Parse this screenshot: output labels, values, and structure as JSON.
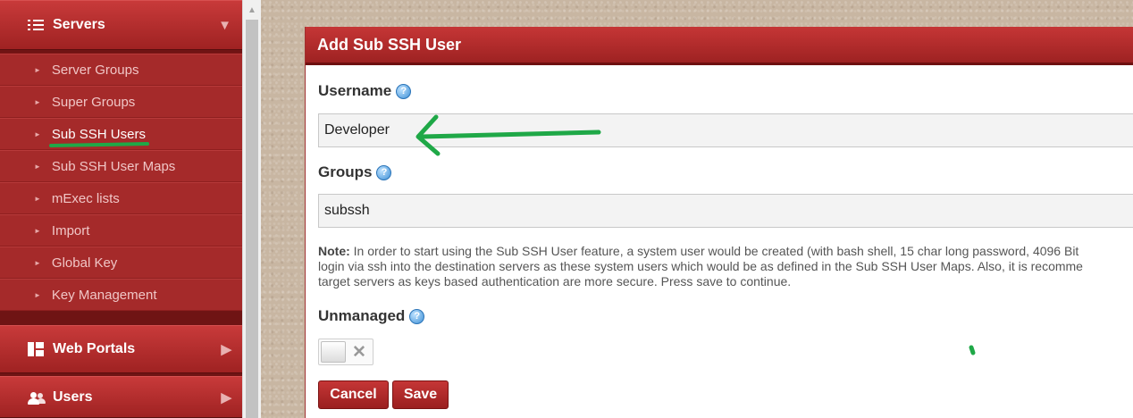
{
  "sidebar": {
    "servers": {
      "label": "Servers",
      "icon": "list-icon"
    },
    "sub_items": [
      {
        "label": "Server Groups"
      },
      {
        "label": "Super Groups"
      },
      {
        "label": "Sub SSH Users"
      },
      {
        "label": "Sub SSH User Maps"
      },
      {
        "label": "mExec lists"
      },
      {
        "label": "Import"
      },
      {
        "label": "Global Key"
      },
      {
        "label": "Key Management"
      }
    ],
    "active_item": "Sub SSH Users",
    "web_portals": {
      "label": "Web Portals",
      "icon": "grid-icon"
    },
    "users": {
      "label": "Users",
      "icon": "users-icon"
    }
  },
  "panel": {
    "title": "Add Sub SSH User",
    "username": {
      "label": "Username",
      "value": "Developer"
    },
    "groups": {
      "label": "Groups",
      "value": "subssh"
    },
    "note": {
      "prefix": "Note:",
      "line1": " In order to start using the Sub SSH User feature, a system user would be created (with bash shell, 15 char long password, 4096 Bit",
      "line2": "login via ssh into the destination servers as these system users which would be as defined in the Sub SSH User Maps. Also, it is recomme",
      "line3": "target servers as keys based authentication are more secure. Press save to continue."
    },
    "unmanaged": {
      "label": "Unmanaged",
      "state": "off"
    },
    "buttons": {
      "cancel": "Cancel",
      "save": "Save"
    }
  },
  "colors": {
    "sidebar_red": "#a52a2a",
    "header_red": "#c53636",
    "annotation_green": "#1fa847"
  }
}
